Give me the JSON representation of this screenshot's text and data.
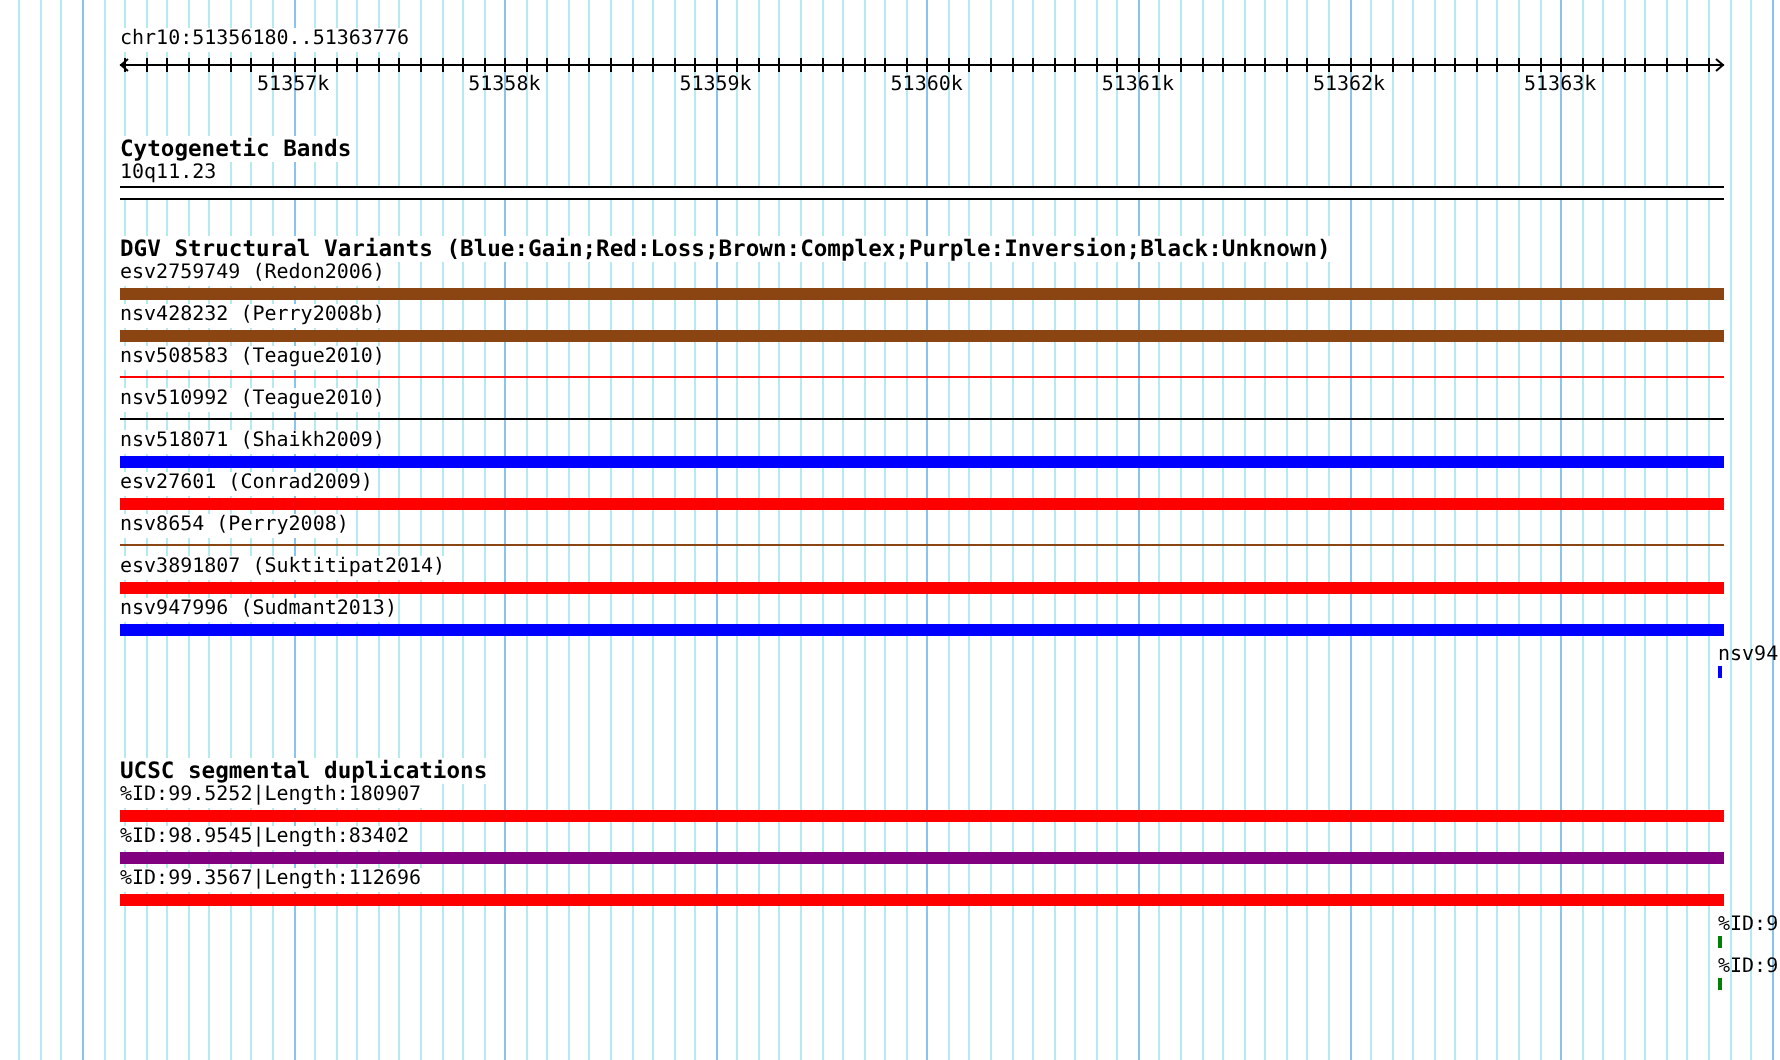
{
  "ruler": {
    "location": "chr10:51356180..51363776",
    "ticks": [
      "51357k",
      "51358k",
      "51359k",
      "51360k",
      "51361k",
      "51362k",
      "51363k"
    ]
  },
  "tracks": [
    {
      "kind": "bands",
      "title": "Cytogenetic Bands",
      "features": [
        {
          "label": "10q11.23"
        }
      ]
    },
    {
      "kind": "features",
      "title": "DGV Structural Variants (Blue:Gain;Red:Loss;Brown:Complex;Purple:Inversion;Black:Unknown)",
      "features": [
        {
          "label": "esv2759749 (Redon2006)",
          "color": "#8b4513",
          "kind": "thick"
        },
        {
          "label": "nsv428232 (Perry2008b)",
          "color": "#8b4513",
          "kind": "thick"
        },
        {
          "label": "nsv508583 (Teague2010)",
          "color": "#ff0000",
          "kind": "thin"
        },
        {
          "label": "nsv510992 (Teague2010)",
          "color": "#000000",
          "kind": "thin"
        },
        {
          "label": "nsv518071 (Shaikh2009)",
          "color": "#0000ff",
          "kind": "thick"
        },
        {
          "label": "esv27601 (Conrad2009)",
          "color": "#ff0000",
          "kind": "thick"
        },
        {
          "label": "nsv8654 (Perry2008)",
          "color": "#8b4513",
          "kind": "thin"
        },
        {
          "label": "esv3891807 (Suktitipat2014)",
          "color": "#ff0000",
          "kind": "thick"
        },
        {
          "label": "nsv947996 (Sudmant2013)",
          "color": "#0000ff",
          "kind": "thick"
        }
      ],
      "clipped": [
        {
          "label": "nsv94",
          "color": "#0000ff"
        }
      ]
    },
    {
      "kind": "features",
      "title": "UCSC segmental duplications",
      "features": [
        {
          "label": "%ID:99.5252|Length:180907",
          "color": "#ff0000",
          "kind": "thick"
        },
        {
          "label": "%ID:98.9545|Length:83402",
          "color": "#800080",
          "kind": "thick"
        },
        {
          "label": "%ID:99.3567|Length:112696",
          "color": "#ff0000",
          "kind": "thick"
        }
      ],
      "clipped": [
        {
          "label": "%ID:9",
          "color": "#008000"
        },
        {
          "label": "%ID:9",
          "color": "#008000"
        }
      ]
    }
  ]
}
